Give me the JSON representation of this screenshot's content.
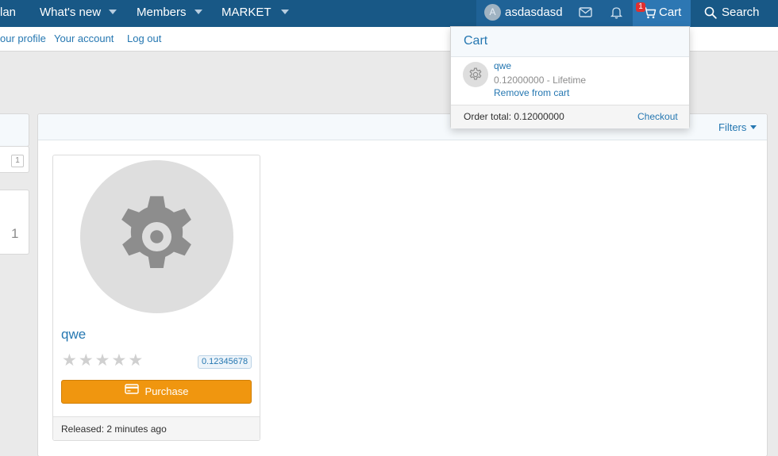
{
  "nav": {
    "partial_item": "lan",
    "whats_new": "What's new",
    "members": "Members",
    "market": "MARKET",
    "username": "asdasdasd",
    "avatar_letter": "A",
    "cart_label": "Cart",
    "cart_count": "1",
    "search_label": "Search"
  },
  "subnav": {
    "your_profile": "our profile",
    "your_account": "Your account",
    "log_out": "Log out"
  },
  "sidebar": {
    "mini_count": "1",
    "big_count": "1"
  },
  "main": {
    "filters_label": "Filters"
  },
  "product": {
    "title": "qwe",
    "rating": 0,
    "rating_max": 5,
    "price": "0.12345678",
    "purchase_label": "Purchase",
    "released": "Released: 2 minutes ago"
  },
  "cart_dropdown": {
    "title": "Cart",
    "item_name": "qwe",
    "item_meta": "0.12000000 - Lifetime",
    "remove_label": "Remove from cart",
    "order_total": "Order total: 0.12000000",
    "checkout_label": "Checkout"
  },
  "colors": {
    "nav_bg": "#185886",
    "link": "#2577b1",
    "purchase_bg": "#f0960f",
    "badge": "#e03030"
  },
  "icons": {
    "mail": "mail-icon",
    "bell": "bell-icon",
    "cart": "cart-icon",
    "search": "search-icon",
    "gear": "gear-icon",
    "star": "star-icon",
    "credit_card": "credit-card-icon"
  }
}
